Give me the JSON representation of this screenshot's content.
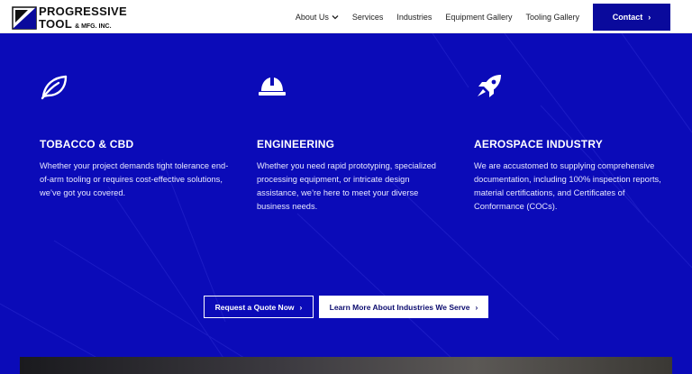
{
  "header": {
    "logo": {
      "line1": "PROGRESSIVE",
      "line2": "TOOL",
      "line2_small": "& MFG. INC."
    },
    "nav": [
      {
        "label": "About Us",
        "has_dropdown": true
      },
      {
        "label": "Services",
        "has_dropdown": false
      },
      {
        "label": "Industries",
        "has_dropdown": false
      },
      {
        "label": "Equipment Gallery",
        "has_dropdown": false
      },
      {
        "label": "Tooling Gallery",
        "has_dropdown": false
      }
    ],
    "contact_label": "Contact"
  },
  "colors": {
    "brand_blue": "#0b0bb8",
    "contact_blue": "#0a0a9c"
  },
  "industries": [
    {
      "icon": "leaf-icon",
      "title": "TOBACCO & CBD",
      "text": "Whether your project demands tight tolerance end-of-arm tooling or requires cost-effective solutions, we’ve got you covered."
    },
    {
      "icon": "hard-hat-icon",
      "title": "ENGINEERING",
      "text": "Whether you need rapid prototyping, specialized processing equipment, or intricate design assistance, we’re here to meet your diverse business needs."
    },
    {
      "icon": "rocket-icon",
      "title": "AEROSPACE INDUSTRY",
      "text": "We are accustomed to supplying comprehensive documentation, including 100% inspection reports, material certifications, and Certificates of Conformance (COCs)."
    }
  ],
  "buttons": {
    "quote": "Request a Quote Now",
    "learn_more": "Learn More About Industries We Serve"
  }
}
